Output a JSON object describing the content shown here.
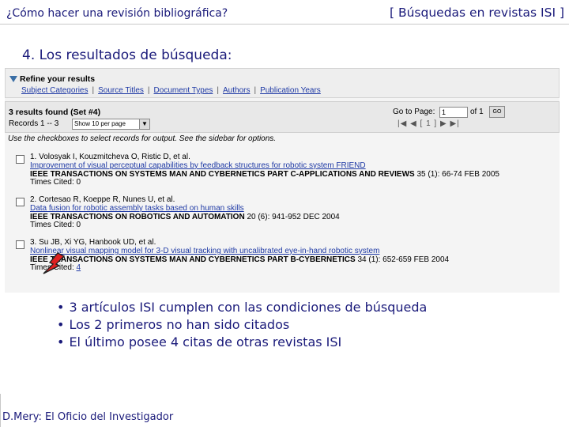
{
  "header": {
    "left": "¿Cómo hacer una revisión bibliográfica?",
    "right": "[ Búsquedas en revistas ISI ]"
  },
  "section_title": "4. Los resultados de búsqueda:",
  "refine": {
    "title": "Refine your results",
    "links": [
      "Subject Categories",
      "Source Titles",
      "Document Types",
      "Authors",
      "Publication Years"
    ]
  },
  "results_bar": {
    "found": "3 results found (Set #4)",
    "records": "Records 1 -- 3",
    "show_select": "Show 10 per page",
    "goto_label": "Go to Page:",
    "page_value": "1",
    "of_label": "of 1",
    "go_button": "GO",
    "pager": "|◀ ◀ [ 1 ] ▶ ▶|"
  },
  "instruction": "Use the checkboxes to select records for output. See the sidebar for options.",
  "records": [
    {
      "number": "1.",
      "authors": "Volosyak I, Kouzmitcheva O, Ristic D, et al.",
      "title": "Improvement of visual perceptual capabilities by feedback structures for robotic system FRIEND",
      "source": "IEEE TRANSACTIONS ON SYSTEMS MAN AND CYBERNETICS PART C-APPLICATIONS AND REVIEWS",
      "source_tail": " 35 (1): 66-74 FEB 2005",
      "times_cited_label": "Times Cited:",
      "times_cited": "0"
    },
    {
      "number": "2.",
      "authors": "Cortesao R, Koeppe R, Nunes U, et al.",
      "title": "Data fusion for robotic assembly tasks based on human skills",
      "source": "IEEE TRANSACTIONS ON ROBOTICS AND AUTOMATION",
      "source_tail": " 20 (6): 941-952 DEC 2004",
      "times_cited_label": "Times Cited:",
      "times_cited": "0"
    },
    {
      "number": "3.",
      "authors": "Su JB, Xi YG, Hanbook UD, et al.",
      "title": "Nonlinear visual mapping model for 3-D visual tracking with uncalibrated eye-in-hand robotic system",
      "source": "IEEE TRANSACTIONS ON SYSTEMS MAN AND CYBERNETICS PART B-CYBERNETICS",
      "source_tail": " 34 (1): 652-659 FEB 2004",
      "times_cited_label": "Times Cited:",
      "times_cited": "4"
    }
  ],
  "bullets": [
    "3 artículos ISI cumplen con las condiciones de búsqueda",
    "Los 2 primeros no han sido citados",
    "El último posee 4 citas de otras revistas ISI"
  ],
  "footer": "D.Mery: El Oficio del Investigador",
  "colors": {
    "text_blue": "#1a1a7a",
    "link_blue": "#1f3aa5",
    "arrow_red": "#e02020"
  }
}
